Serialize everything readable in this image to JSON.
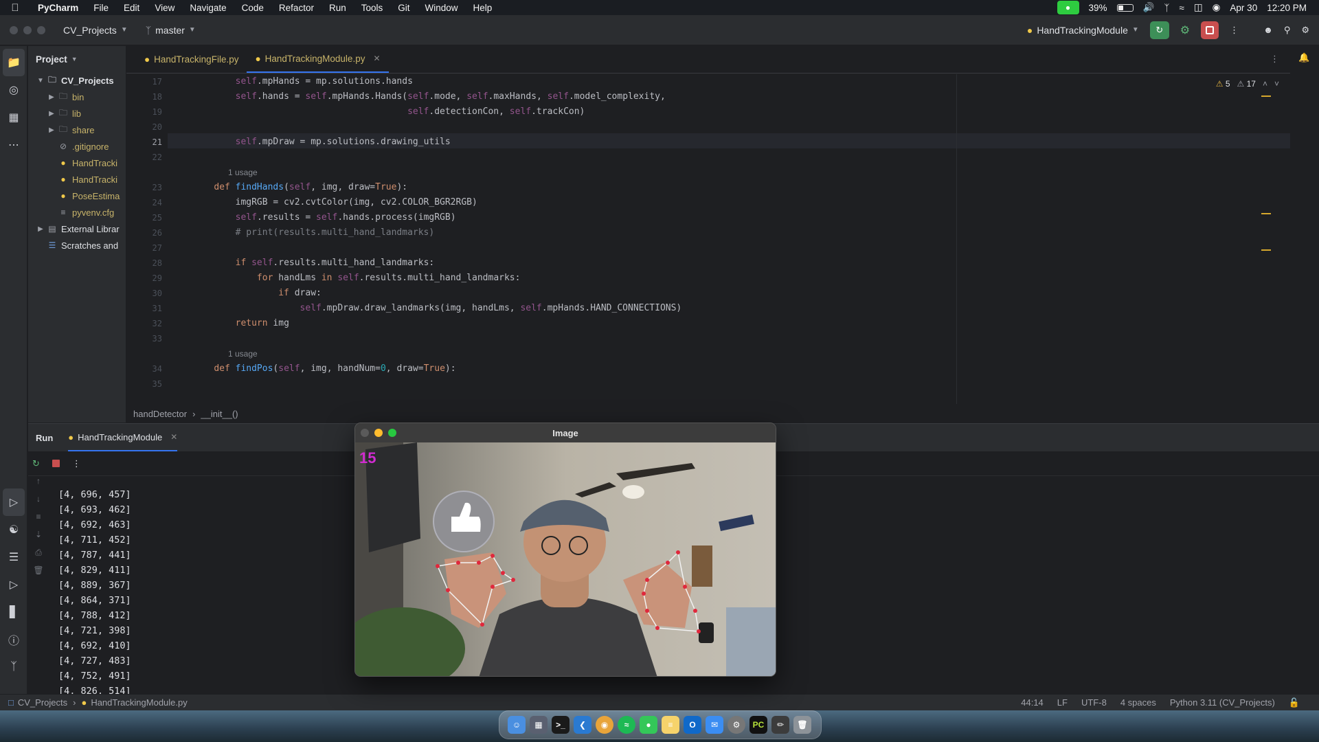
{
  "menubar": {
    "app_name": "PyCharm",
    "items": [
      "File",
      "Edit",
      "View",
      "Navigate",
      "Code",
      "Refactor",
      "Run",
      "Tools",
      "Git",
      "Window",
      "Help"
    ],
    "battery": "39%",
    "battery_level": 0.39,
    "date": "Apr 30",
    "time": "12:20 PM"
  },
  "titlebar": {
    "project": "CV_Projects",
    "branch": "master",
    "run_config": "HandTrackingModule"
  },
  "project_panel": {
    "title": "Project",
    "root": "CV_Projects",
    "folders": [
      "bin",
      "lib",
      "share"
    ],
    "files": [
      ".gitignore",
      "HandTracki",
      "HandTracki",
      "PoseEstima",
      "pyvenv.cfg"
    ],
    "external": "External Librar",
    "scratches": "Scratches and"
  },
  "editor": {
    "tabs": [
      "HandTrackingFile.py",
      "HandTrackingModule.py"
    ],
    "warnings": "5",
    "weak_warnings": "17",
    "line_numbers": [
      "17",
      "18",
      "19",
      "20",
      "21",
      "22",
      "",
      "23",
      "24",
      "25",
      "26",
      "27",
      "28",
      "29",
      "30",
      "31",
      "32",
      "33",
      "",
      "34",
      "35"
    ],
    "usage_hint": "1 usage",
    "breadcrumb": [
      "handDetector",
      "__init__()"
    ]
  },
  "run_panel": {
    "tab_run": "Run",
    "tab_config": "HandTrackingModule",
    "output": [
      "[4, 696, 457]",
      "[4, 693, 462]",
      "[4, 692, 463]",
      "[4, 711, 452]",
      "[4, 787, 441]",
      "[4, 829, 411]",
      "[4, 889, 367]",
      "[4, 864, 371]",
      "[4, 788, 412]",
      "[4, 721, 398]",
      "[4, 692, 410]",
      "[4, 727, 483]",
      "[4, 752, 491]",
      "[4, 826, 514]"
    ]
  },
  "image_window": {
    "title": "Image",
    "fps": "15"
  },
  "statusbar": {
    "project": "CV_Projects",
    "file": "HandTrackingModule.py",
    "position": "44:14",
    "line_sep": "LF",
    "encoding": "UTF-8",
    "indent": "4 spaces",
    "interpreter": "Python 3.11 (CV_Projects)"
  },
  "colors": {
    "accent": "#3574f0",
    "run_green": "#3d8f58",
    "stop_red": "#c94f4f",
    "landmark_red": "#e0283c",
    "fps_magenta": "#d12bd1"
  }
}
